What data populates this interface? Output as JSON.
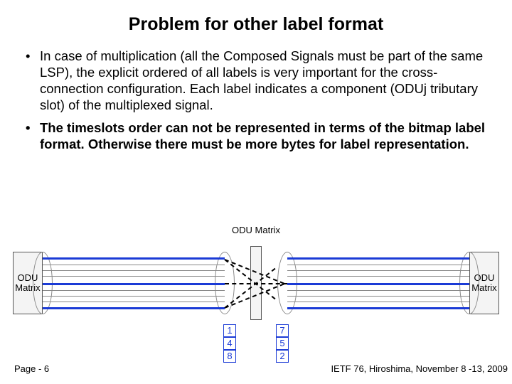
{
  "title": "Problem for other label format",
  "bullets": [
    "In case of multiplication (all the Composed Signals must be part of the same LSP), the explicit ordered of all labels is very important for the cross-connection configuration. Each label indicates a component (ODUj tributary slot) of the multiplexed signal.",
    "The timeslots order can not be represented in terms of the bitmap label format. Otherwise there must be more bytes for label representation."
  ],
  "diagram": {
    "left_box": "ODU\nMatrix",
    "right_box": "ODU\nMatrix",
    "center_label": "ODU Matrix",
    "left_numbers": [
      "1",
      "4",
      "8"
    ],
    "right_numbers": [
      "7",
      "5",
      "2"
    ]
  },
  "footer": {
    "page": "Page - 6",
    "conf": "IETF 76, Hiroshima, November 8 -13, 2009"
  }
}
